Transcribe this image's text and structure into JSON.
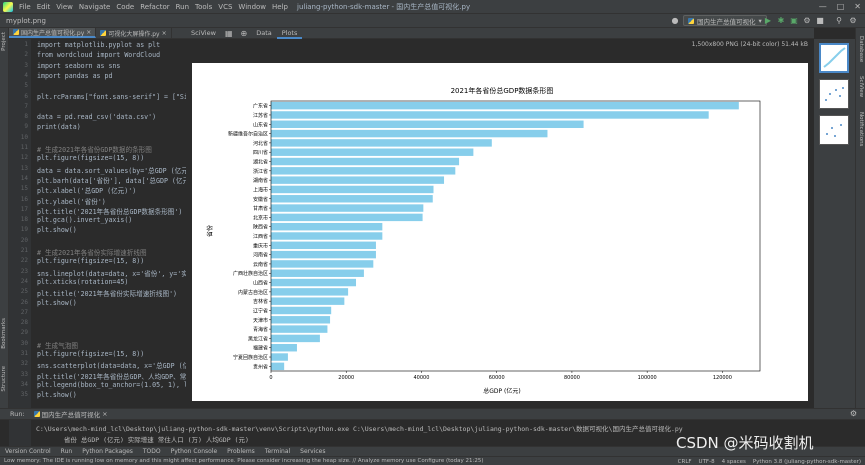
{
  "menubar": {
    "items": [
      "File",
      "Edit",
      "View",
      "Navigate",
      "Code",
      "Refactor",
      "Run",
      "Tools",
      "VCS",
      "Window",
      "Help"
    ],
    "window_title": "juliang-python-sdk-master - 国内生产总值可视化.py"
  },
  "toolbar": {
    "breadcrumb": "myplot.png",
    "run_config": "国内生产总值可视化"
  },
  "left_strip": {
    "labels": [
      "Project",
      "Bookmarks",
      "Structure"
    ]
  },
  "right_strip": {
    "labels": [
      "Database",
      "SciView",
      "Notifications"
    ]
  },
  "editor_tabs": [
    {
      "label": "国内生产总值可视化.py",
      "active": true
    },
    {
      "label": "可视化大屏操作.py",
      "active": false
    }
  ],
  "code_lines": [
    {
      "n": "1",
      "t": "import matplotlib.pyplot as plt",
      "c": "plain"
    },
    {
      "n": "2",
      "t": "from wordcloud import WordCloud",
      "c": "plain"
    },
    {
      "n": "3",
      "t": "import seaborn as sns",
      "c": "plain"
    },
    {
      "n": "4",
      "t": "import pandas as pd",
      "c": "plain"
    },
    {
      "n": "5",
      "t": "",
      "c": "plain"
    },
    {
      "n": "6",
      "t": "plt.rcParams[\"font.sans-serif\"] = [\"SimHei\"]",
      "c": "plain"
    },
    {
      "n": "7",
      "t": "",
      "c": "plain"
    },
    {
      "n": "8",
      "t": "data = pd.read_csv('data.csv')",
      "c": "plain"
    },
    {
      "n": "9",
      "t": "print(data)",
      "c": "plain"
    },
    {
      "n": "10",
      "t": "",
      "c": "plain"
    },
    {
      "n": "11",
      "t": "# 生成2021年各省份GDP数据的条形图",
      "c": "comment"
    },
    {
      "n": "12",
      "t": "plt.figure(figsize=(15, 8))",
      "c": "plain"
    },
    {
      "n": "13",
      "t": "data = data.sort_values(by='总GDP (亿元)', ascending=False)",
      "c": "plain"
    },
    {
      "n": "14",
      "t": "plt.barh(data['省份'], data['总GDP (亿元)'], color='skyblue')",
      "c": "plain"
    },
    {
      "n": "15",
      "t": "plt.xlabel('总GDP (亿元)')",
      "c": "plain"
    },
    {
      "n": "16",
      "t": "plt.ylabel('省份')",
      "c": "plain"
    },
    {
      "n": "17",
      "t": "plt.title('2021年各省份总GDP数据条形图')",
      "c": "plain"
    },
    {
      "n": "18",
      "t": "plt.gca().invert_yaxis()",
      "c": "plain"
    },
    {
      "n": "19",
      "t": "plt.show()",
      "c": "plain"
    },
    {
      "n": "20",
      "t": "",
      "c": "plain"
    },
    {
      "n": "21",
      "t": "# 生成2021年各省份实际增速折线图",
      "c": "comment"
    },
    {
      "n": "22",
      "t": "plt.figure(figsize=(15, 8))",
      "c": "plain"
    },
    {
      "n": "23",
      "t": "sns.lineplot(data=data, x='省份', y='实际增速')",
      "c": "plain"
    },
    {
      "n": "24",
      "t": "plt.xticks(rotation=45)",
      "c": "plain"
    },
    {
      "n": "25",
      "t": "plt.title('2021年各省份实际增速折线图')",
      "c": "plain"
    },
    {
      "n": "26",
      "t": "plt.show()",
      "c": "plain"
    },
    {
      "n": "27",
      "t": "",
      "c": "plain"
    },
    {
      "n": "28",
      "t": "",
      "c": "plain"
    },
    {
      "n": "29",
      "t": "",
      "c": "plain"
    },
    {
      "n": "30",
      "t": "# 生成气泡图",
      "c": "comment"
    },
    {
      "n": "31",
      "t": "plt.figure(figsize=(15, 8))",
      "c": "plain"
    },
    {
      "n": "32",
      "t": "sns.scatterplot(data=data, x='总GDP (亿元)', y='人均GDP')",
      "c": "plain"
    },
    {
      "n": "33",
      "t": "plt.title('2021年各省份总GDP、人均GDP、常住人口')",
      "c": "plain"
    },
    {
      "n": "34",
      "t": "plt.legend(bbox_to_anchor=(1.05, 1), loc='upper left')",
      "c": "plain"
    },
    {
      "n": "35",
      "t": "plt.show()",
      "c": "plain"
    }
  ],
  "viewer": {
    "tabs": [
      {
        "label": "SciView",
        "active": false
      },
      {
        "label": "Data",
        "active": false
      },
      {
        "label": "Plots",
        "active": true
      }
    ],
    "image_info": "1,500x800 PNG (24-bit color) 51.44 kB"
  },
  "chart_data": {
    "type": "bar",
    "orientation": "horizontal",
    "title": "2021年各省份总GDP数据条形图",
    "xlabel": "总GDP (亿元)",
    "ylabel": "省份",
    "xlim": [
      0,
      130000
    ],
    "xticks": [
      0,
      20000,
      40000,
      60000,
      80000,
      100000,
      120000
    ],
    "bar_color": "#87ceeb",
    "categories": [
      "广东省",
      "江苏省",
      "山东省",
      "新疆维吾尔自治区",
      "河北省",
      "四川省",
      "湖北省",
      "浙江省",
      "湖南省",
      "上海市",
      "安徽省",
      "甘肃省",
      "北京市",
      "陕西省",
      "江西省",
      "重庆市",
      "河南省",
      "云南省",
      "广西壮族自治区",
      "山西省",
      "内蒙古自治区",
      "吉林省",
      "辽宁省",
      "天津市",
      "青海省",
      "黑龙江省",
      "福建省",
      "宁夏回族自治区",
      "贵州省"
    ],
    "values": [
      124370,
      116360,
      83100,
      73500,
      58700,
      53800,
      50000,
      49000,
      46000,
      43200,
      43000,
      40500,
      40300,
      29600,
      29600,
      27900,
      27900,
      27200,
      24700,
      22600,
      20500,
      19500,
      16000,
      15700,
      15000,
      13000,
      6900,
      4500,
      3500
    ],
    "grid": false,
    "legend": false
  },
  "run_panel": {
    "label": "Run:",
    "tab": "国内生产总值可视化",
    "command": "C:\\Users\\mech-mind_lcl\\Desktop\\juliang-python-sdk-master\\venv\\Scripts\\python.exe C:\\Users\\mech-mind_lcl\\Desktop\\juliang-python-sdk-master\\数据可视化\\国内生产总值可视化.py",
    "output_header": "省份  总GDP (亿元)  实际增速  常住人口 (万)  人均GDP (元)"
  },
  "bottom_tabs": [
    "Version Control",
    "Run",
    "Python Packages",
    "TODO",
    "Python Console",
    "Problems",
    "Terminal",
    "Services"
  ],
  "status": {
    "message": "Low memory: The IDE is running low on memory and this might affect performance. Please consider increasing the heap size. // Analyze memory use   Configure (today 21:25)",
    "crlf": "CRLF",
    "encoding": "UTF-8",
    "indent": "4 spaces",
    "interpreter": "Python 3.8 (juliang-python-sdk-master)"
  },
  "watermark": "CSDN @米码收割机"
}
